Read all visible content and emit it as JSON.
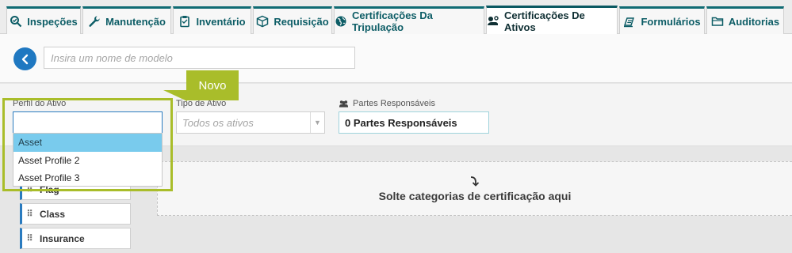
{
  "tabs": [
    {
      "label": "Inspeções",
      "icon": "search-check-icon"
    },
    {
      "label": "Manutenção",
      "icon": "wrench-icon"
    },
    {
      "label": "Inventário",
      "icon": "clipboard-icon"
    },
    {
      "label": "Requisição",
      "icon": "box-icon"
    },
    {
      "label": "Certificações Da Tripulação",
      "icon": "globe-icon"
    },
    {
      "label": "Certificações De Ativos",
      "icon": "asset-cert-icon",
      "active": true
    },
    {
      "label": "Formulários",
      "icon": "forms-icon"
    },
    {
      "label": "Auditorias",
      "icon": "folder-icon"
    }
  ],
  "header": {
    "model_placeholder": "Insira um nome de modelo"
  },
  "filters": {
    "asset_profile_label": "Perfil do Ativo",
    "asset_type_label": "Tipo de Ativo",
    "asset_type_placeholder": "Todos os ativos",
    "parties_label": "Partes Responsáveis",
    "parties_value": "0 Partes Responsáveis"
  },
  "dropdown": {
    "items": [
      "Asset",
      "Asset Profile 2",
      "Asset Profile 3"
    ],
    "selected": "Asset"
  },
  "callout": {
    "label": "Novo"
  },
  "categories": [
    "Flag",
    "Class",
    "Insurance"
  ],
  "dropzone": {
    "text": "Solte categorias de certificação aqui"
  },
  "colors": {
    "accent": "#0f6b73",
    "highlight": "#a9bd2a",
    "selected": "#79cbed",
    "primary": "#1f78c1"
  }
}
